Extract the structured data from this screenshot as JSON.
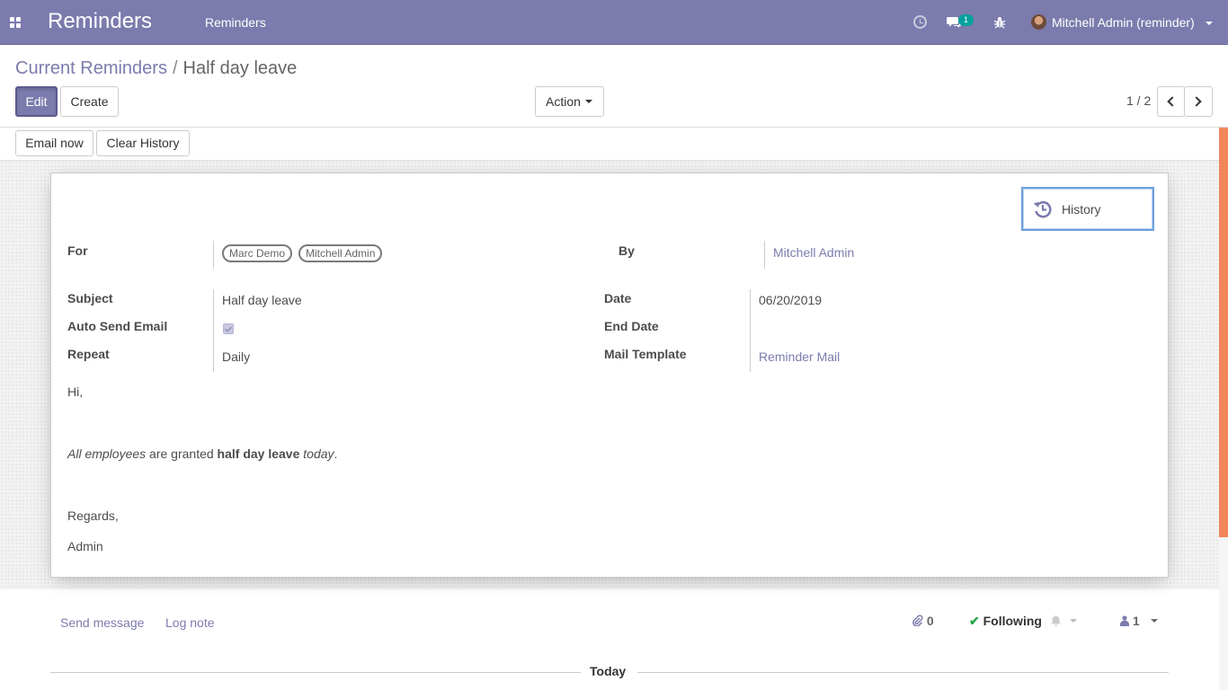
{
  "navbar": {
    "brand": "Reminders",
    "menu": "Reminders",
    "chat_badge": "1",
    "user": "Mitchell Admin (reminder)"
  },
  "breadcrumb": {
    "parent": "Current Reminders",
    "separator": "/",
    "current": "Half day leave"
  },
  "buttons": {
    "edit": "Edit",
    "create": "Create",
    "action": "Action"
  },
  "pager": {
    "value": "1 / 2"
  },
  "statusbar": {
    "email_now": "Email now",
    "clear_history": "Clear History"
  },
  "form": {
    "history_button": "History",
    "for_label": "For",
    "for_tags": [
      "Marc Demo",
      "Mitchell Admin"
    ],
    "by_label": "By",
    "by_value": "Mitchell Admin",
    "subject_label": "Subject",
    "subject_value": "Half day leave",
    "auto_send_label": "Auto Send Email",
    "auto_send_checked": true,
    "repeat_label": "Repeat",
    "repeat_value": "Daily",
    "date_label": "Date",
    "date_value": "06/20/2019",
    "end_date_label": "End Date",
    "end_date_value": "",
    "mail_template_label": "Mail Template",
    "mail_template_value": "Reminder Mail"
  },
  "message_body": {
    "greeting": "Hi,",
    "line_em1": "All employees",
    "line_mid": " are granted ",
    "line_bold": "half day leave",
    "line_sp": " ",
    "line_em2": "today",
    "line_end": ".",
    "regards": "Regards,",
    "signature": "Admin"
  },
  "chatter": {
    "send_message": "Send message",
    "log_note": "Log note",
    "attachments": "0",
    "following": "Following",
    "followers": "1",
    "today": "Today"
  },
  "colors": {
    "brand": "#7c7bad",
    "scroll_accent": "#f0875a",
    "badge": "#00a09d"
  }
}
